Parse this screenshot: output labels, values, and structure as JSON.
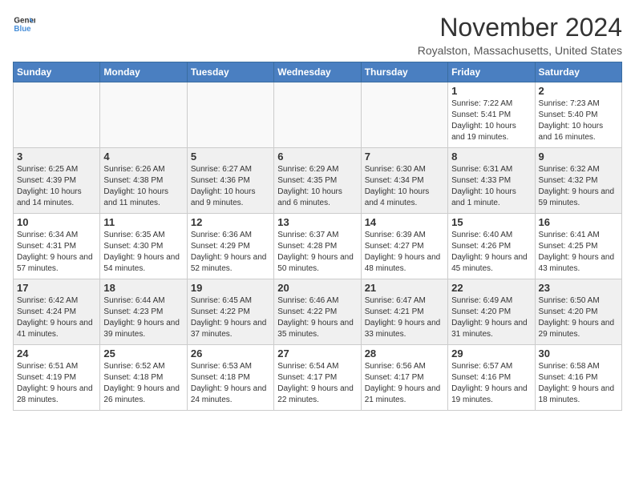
{
  "logo": {
    "line1": "General",
    "line2": "Blue"
  },
  "title": "November 2024",
  "location": "Royalston, Massachusetts, United States",
  "days_of_week": [
    "Sunday",
    "Monday",
    "Tuesday",
    "Wednesday",
    "Thursday",
    "Friday",
    "Saturday"
  ],
  "weeks": [
    [
      {
        "day": "",
        "content": ""
      },
      {
        "day": "",
        "content": ""
      },
      {
        "day": "",
        "content": ""
      },
      {
        "day": "",
        "content": ""
      },
      {
        "day": "",
        "content": ""
      },
      {
        "day": "1",
        "content": "Sunrise: 7:22 AM\nSunset: 5:41 PM\nDaylight: 10 hours and 19 minutes."
      },
      {
        "day": "2",
        "content": "Sunrise: 7:23 AM\nSunset: 5:40 PM\nDaylight: 10 hours and 16 minutes."
      }
    ],
    [
      {
        "day": "3",
        "content": "Sunrise: 6:25 AM\nSunset: 4:39 PM\nDaylight: 10 hours and 14 minutes."
      },
      {
        "day": "4",
        "content": "Sunrise: 6:26 AM\nSunset: 4:38 PM\nDaylight: 10 hours and 11 minutes."
      },
      {
        "day": "5",
        "content": "Sunrise: 6:27 AM\nSunset: 4:36 PM\nDaylight: 10 hours and 9 minutes."
      },
      {
        "day": "6",
        "content": "Sunrise: 6:29 AM\nSunset: 4:35 PM\nDaylight: 10 hours and 6 minutes."
      },
      {
        "day": "7",
        "content": "Sunrise: 6:30 AM\nSunset: 4:34 PM\nDaylight: 10 hours and 4 minutes."
      },
      {
        "day": "8",
        "content": "Sunrise: 6:31 AM\nSunset: 4:33 PM\nDaylight: 10 hours and 1 minute."
      },
      {
        "day": "9",
        "content": "Sunrise: 6:32 AM\nSunset: 4:32 PM\nDaylight: 9 hours and 59 minutes."
      }
    ],
    [
      {
        "day": "10",
        "content": "Sunrise: 6:34 AM\nSunset: 4:31 PM\nDaylight: 9 hours and 57 minutes."
      },
      {
        "day": "11",
        "content": "Sunrise: 6:35 AM\nSunset: 4:30 PM\nDaylight: 9 hours and 54 minutes."
      },
      {
        "day": "12",
        "content": "Sunrise: 6:36 AM\nSunset: 4:29 PM\nDaylight: 9 hours and 52 minutes."
      },
      {
        "day": "13",
        "content": "Sunrise: 6:37 AM\nSunset: 4:28 PM\nDaylight: 9 hours and 50 minutes."
      },
      {
        "day": "14",
        "content": "Sunrise: 6:39 AM\nSunset: 4:27 PM\nDaylight: 9 hours and 48 minutes."
      },
      {
        "day": "15",
        "content": "Sunrise: 6:40 AM\nSunset: 4:26 PM\nDaylight: 9 hours and 45 minutes."
      },
      {
        "day": "16",
        "content": "Sunrise: 6:41 AM\nSunset: 4:25 PM\nDaylight: 9 hours and 43 minutes."
      }
    ],
    [
      {
        "day": "17",
        "content": "Sunrise: 6:42 AM\nSunset: 4:24 PM\nDaylight: 9 hours and 41 minutes."
      },
      {
        "day": "18",
        "content": "Sunrise: 6:44 AM\nSunset: 4:23 PM\nDaylight: 9 hours and 39 minutes."
      },
      {
        "day": "19",
        "content": "Sunrise: 6:45 AM\nSunset: 4:22 PM\nDaylight: 9 hours and 37 minutes."
      },
      {
        "day": "20",
        "content": "Sunrise: 6:46 AM\nSunset: 4:22 PM\nDaylight: 9 hours and 35 minutes."
      },
      {
        "day": "21",
        "content": "Sunrise: 6:47 AM\nSunset: 4:21 PM\nDaylight: 9 hours and 33 minutes."
      },
      {
        "day": "22",
        "content": "Sunrise: 6:49 AM\nSunset: 4:20 PM\nDaylight: 9 hours and 31 minutes."
      },
      {
        "day": "23",
        "content": "Sunrise: 6:50 AM\nSunset: 4:20 PM\nDaylight: 9 hours and 29 minutes."
      }
    ],
    [
      {
        "day": "24",
        "content": "Sunrise: 6:51 AM\nSunset: 4:19 PM\nDaylight: 9 hours and 28 minutes."
      },
      {
        "day": "25",
        "content": "Sunrise: 6:52 AM\nSunset: 4:18 PM\nDaylight: 9 hours and 26 minutes."
      },
      {
        "day": "26",
        "content": "Sunrise: 6:53 AM\nSunset: 4:18 PM\nDaylight: 9 hours and 24 minutes."
      },
      {
        "day": "27",
        "content": "Sunrise: 6:54 AM\nSunset: 4:17 PM\nDaylight: 9 hours and 22 minutes."
      },
      {
        "day": "28",
        "content": "Sunrise: 6:56 AM\nSunset: 4:17 PM\nDaylight: 9 hours and 21 minutes."
      },
      {
        "day": "29",
        "content": "Sunrise: 6:57 AM\nSunset: 4:16 PM\nDaylight: 9 hours and 19 minutes."
      },
      {
        "day": "30",
        "content": "Sunrise: 6:58 AM\nSunset: 4:16 PM\nDaylight: 9 hours and 18 minutes."
      }
    ]
  ]
}
